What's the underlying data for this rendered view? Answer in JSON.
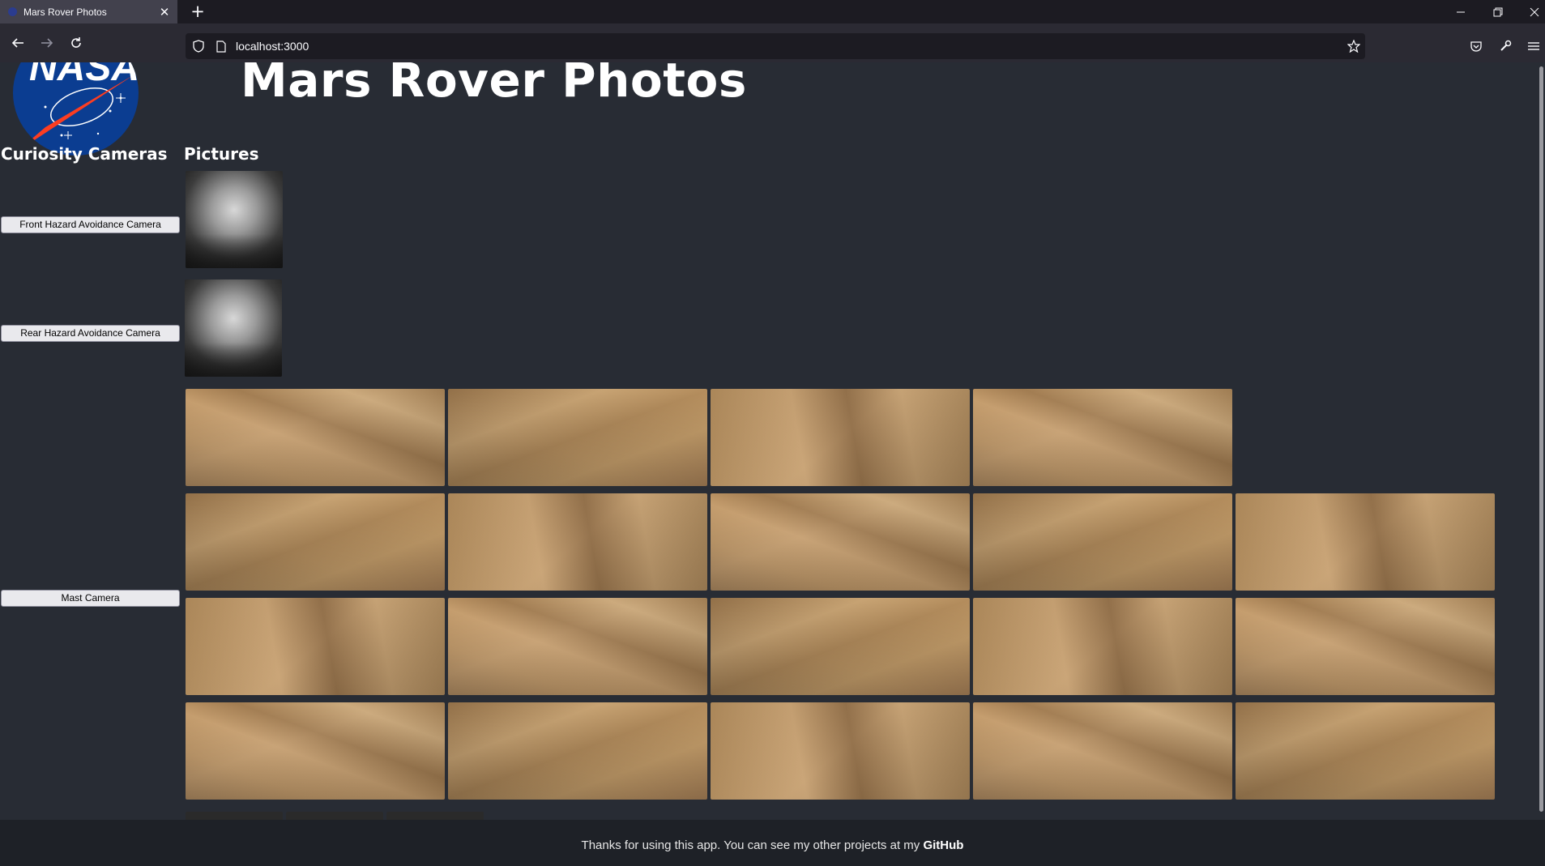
{
  "browser": {
    "tab_title": "Mars Rover Photos",
    "tab_close": "✕",
    "new_tab": "+",
    "url": "localhost:3000"
  },
  "page": {
    "title": "Mars Rover Photos",
    "sidebar_heading": "Curiosity Cameras",
    "pictures_heading": "Pictures"
  },
  "cameras": [
    {
      "label": "Front Hazard Avoidance Camera",
      "photo_count": 1
    },
    {
      "label": "Rear Hazard Avoidance Camera",
      "photo_count": 1
    },
    {
      "label": "Mast Camera",
      "photo_count": 19
    }
  ],
  "footer": {
    "text": "Thanks for using this app. You can see my other projects at my",
    "link": "GitHub"
  }
}
